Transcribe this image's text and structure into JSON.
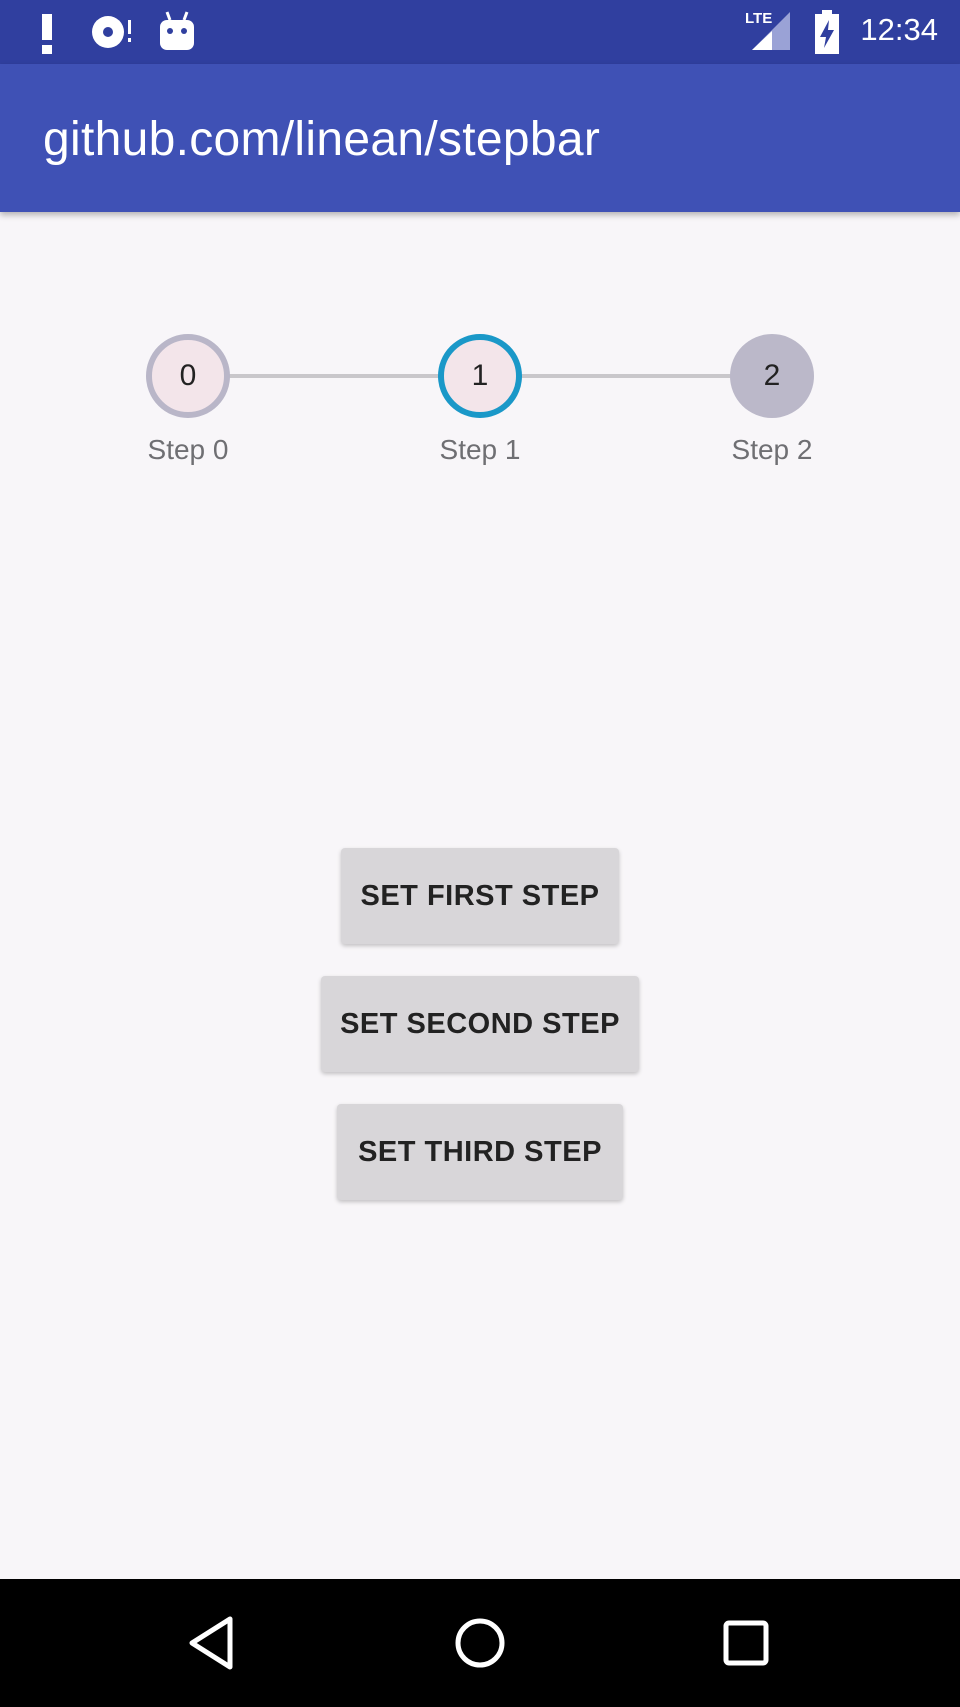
{
  "status_bar": {
    "time": "12:34",
    "network": "LTE",
    "icons": [
      "alert-icon",
      "disc-icon",
      "android-icon",
      "lte-signal-icon",
      "battery-charging-icon"
    ],
    "background": "#303f9f"
  },
  "app_bar": {
    "title": "github.com/linean/stepbar",
    "background": "#3f51b5"
  },
  "stepbar": {
    "current_step": 1,
    "active_color": "#1a98c8",
    "steps": [
      {
        "number": "0",
        "label": "Step 0",
        "state": "done"
      },
      {
        "number": "1",
        "label": "Step 1",
        "state": "current"
      },
      {
        "number": "2",
        "label": "Step 2",
        "state": "pending"
      }
    ]
  },
  "buttons": {
    "first": "SET FIRST STEP",
    "second": "SET SECOND STEP",
    "third": "SET THIRD STEP"
  },
  "nav_bar": {
    "icons": [
      "back-icon",
      "home-icon",
      "recents-icon"
    ]
  }
}
